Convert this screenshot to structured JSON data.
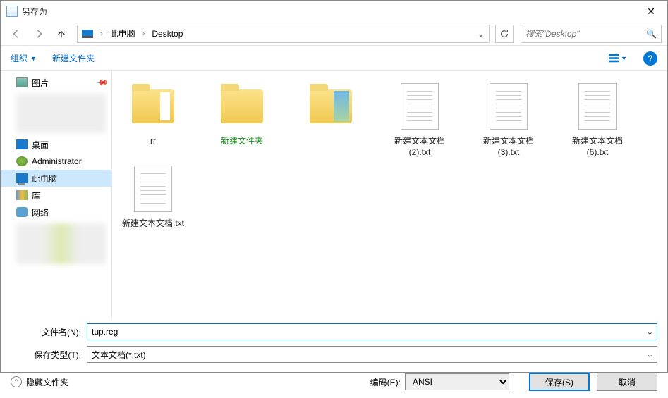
{
  "window": {
    "title": "另存为"
  },
  "breadcrumb": {
    "parts": [
      "此电脑",
      "Desktop"
    ]
  },
  "search": {
    "placeholder": "搜索\"Desktop\""
  },
  "toolbar": {
    "organize": "组织",
    "newfolder": "新建文件夹"
  },
  "sidebar": {
    "picture": "图片",
    "desktop": "桌面",
    "admin": "Administrator",
    "thispc": "此电脑",
    "library": "库",
    "network": "网络"
  },
  "files": [
    {
      "type": "folder-open",
      "name": "rr"
    },
    {
      "type": "folder",
      "name": "新建文件夹",
      "highlight": true
    },
    {
      "type": "folder-pic",
      "name": ""
    },
    {
      "type": "txt",
      "name": "新建文本文档 (2).txt"
    },
    {
      "type": "txt",
      "name": "新建文本文档 (3).txt"
    },
    {
      "type": "txt",
      "name": "新建文本文档 (6).txt"
    },
    {
      "type": "txt",
      "name": "新建文本文档.txt"
    }
  ],
  "form": {
    "filename_label": "文件名(N):",
    "filename_value": "tup.reg",
    "filetype_label": "保存类型(T):",
    "filetype_value": "文本文档(*.txt)"
  },
  "footer": {
    "hide": "隐藏文件夹",
    "encoding_label": "编码(E):",
    "encoding_value": "ANSI",
    "save": "保存(S)",
    "cancel": "取消"
  }
}
